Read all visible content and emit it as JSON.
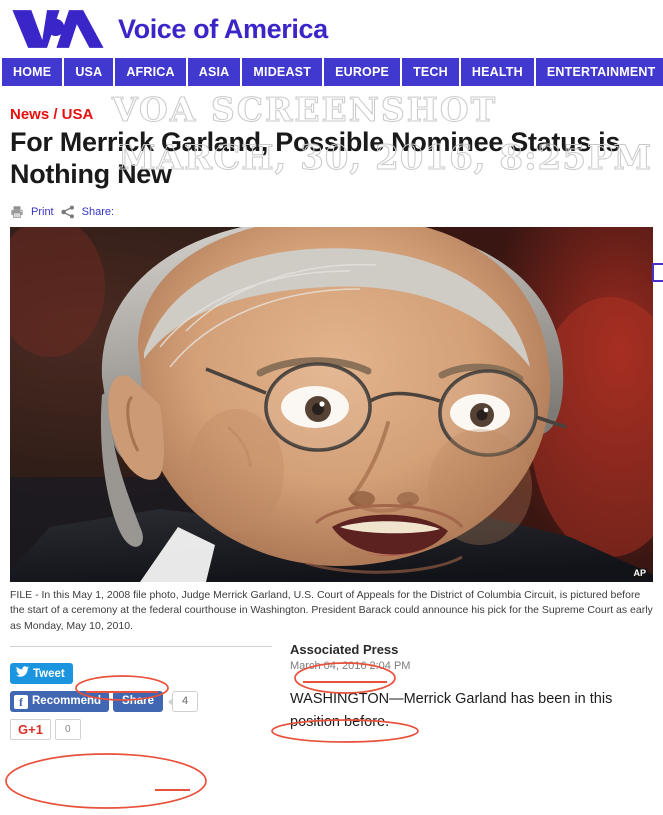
{
  "site": {
    "logo_alt": "VOA",
    "brand_name": "Voice of America"
  },
  "nav": {
    "items": [
      {
        "label": "HOME"
      },
      {
        "label": "USA"
      },
      {
        "label": "AFRICA"
      },
      {
        "label": "ASIA"
      },
      {
        "label": "MIDEAST"
      },
      {
        "label": "EUROPE"
      },
      {
        "label": "TECH"
      },
      {
        "label": "HEALTH"
      },
      {
        "label": "ENTERTAINMENT"
      }
    ]
  },
  "watermark": {
    "line1": "VOA SCREENSHOT",
    "line2": "MARCH, 30, 2016, 8:25PM"
  },
  "article": {
    "kicker": "News / USA",
    "headline": "For Merrick Garland, Possible Nominee Status is Nothing New",
    "toolbar": {
      "print_label": "Print",
      "share_label": "Share:"
    },
    "photo": {
      "credit": "AP",
      "caption": "FILE - In this May 1, 2008 file photo, Judge Merrick Garland, U.S. Court of Appeals for the District of Columbia Circuit, is pictured before the start of a ceremony at the federal courthouse in Washington. President Barack could announce his pick for the Supreme Court as early as Monday, May 10, 2010."
    },
    "byline": "Associated Press",
    "pubdate": "March 04, 2016 2:04 PM",
    "body": "WASHINGTON—Merrick Garland has been in this position before."
  },
  "social": {
    "tweet_label": "Tweet",
    "facebook_recommend_label": "Recommend",
    "facebook_share_label": "Share",
    "facebook_share_count": "4",
    "gplus_label": "G+1",
    "gplus_count": "0"
  },
  "colors": {
    "brand_purple": "#4038cf",
    "kicker_red": "#e8100f",
    "annotation_red": "#e8513c",
    "twitter_blue": "#1b95e0",
    "facebook_blue": "#4267B2"
  }
}
